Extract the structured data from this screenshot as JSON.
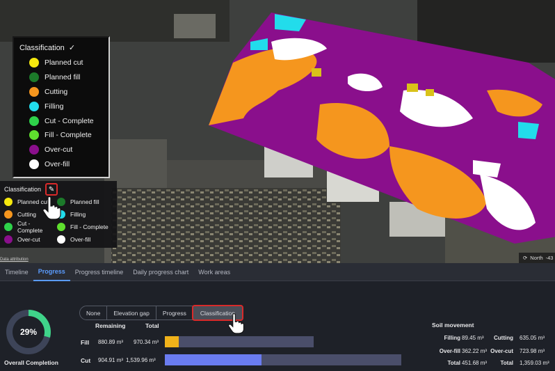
{
  "colors": {
    "planned_cut": "#f5e80e",
    "planned_fill": "#1c7a2a",
    "cutting": "#f5961e",
    "filling": "#22dceb",
    "cut_complete": "#2ed24a",
    "fill_complete": "#5fe02e",
    "over_cut": "#8a0f8c",
    "over_fill": "#ffffff",
    "accent": "#5b9cff",
    "highlight": "#d92a2a",
    "cut_bar": "#6a7cf0",
    "fill_bar": "#f0b21a",
    "donut_progress": "#3fd48a",
    "donut_track": "#3d4458"
  },
  "map": {
    "classification_panel": {
      "title": "Classification",
      "check_icon": "check-icon",
      "items": [
        {
          "label": "Planned cut",
          "color_key": "planned_cut"
        },
        {
          "label": "Planned fill",
          "color_key": "planned_fill"
        },
        {
          "label": "Cutting",
          "color_key": "cutting"
        },
        {
          "label": "Filling",
          "color_key": "filling"
        },
        {
          "label": "Cut - Complete",
          "color_key": "cut_complete"
        },
        {
          "label": "Fill - Complete",
          "color_key": "fill_complete"
        },
        {
          "label": "Over-cut",
          "color_key": "over_cut"
        },
        {
          "label": "Over-fill",
          "color_key": "over_fill"
        }
      ]
    },
    "legend": {
      "title": "Classification",
      "edit_icon": "pencil-icon",
      "items": [
        {
          "label": "Planned cut",
          "color_key": "planned_cut"
        },
        {
          "label": "Planned fill",
          "color_key": "planned_fill"
        },
        {
          "label": "Cutting",
          "color_key": "cutting"
        },
        {
          "label": "Filling",
          "color_key": "filling"
        },
        {
          "label": "Cut - Complete",
          "color_key": "cut_complete"
        },
        {
          "label": "Fill - Complete",
          "color_key": "fill_complete"
        },
        {
          "label": "Over-cut",
          "color_key": "over_cut"
        },
        {
          "label": "Over-fill",
          "color_key": "over_fill"
        }
      ]
    },
    "attribution": "Data attribution",
    "north_label": "North",
    "north_value": "-43"
  },
  "tabs": [
    "Timeline",
    "Progress",
    "Progress timeline",
    "Daily progress chart",
    "Work areas"
  ],
  "active_tab": "Progress",
  "overall": {
    "percent_label": "29%",
    "percent": 0.29,
    "label": "Overall Completion"
  },
  "view_modes": [
    "None",
    "Elevation gap",
    "Progress",
    "Classification"
  ],
  "active_view_mode": "Classification",
  "progress_table": {
    "headers": {
      "remaining": "Remaining",
      "total": "Total"
    },
    "rows": [
      {
        "label": "Fill",
        "remaining": "880.89 m³",
        "total": "970.34 m³",
        "progress": 0.092
      },
      {
        "label": "Cut",
        "remaining": "904.91 m³",
        "total": "1,539.96 m³",
        "progress": 0.41
      }
    ]
  },
  "soil_movement": {
    "title": "Soil movement",
    "left": [
      {
        "label": "Filling",
        "value": "89.45 m³"
      },
      {
        "label": "Over-fill",
        "value": "362.22 m³"
      },
      {
        "label": "Total",
        "value": "451.68 m³"
      }
    ],
    "right": [
      {
        "label": "Cutting",
        "value": "635.05 m³"
      },
      {
        "label": "Over-cut",
        "value": "723.98 m³"
      },
      {
        "label": "Total",
        "value": "1,359.03 m³"
      }
    ]
  }
}
